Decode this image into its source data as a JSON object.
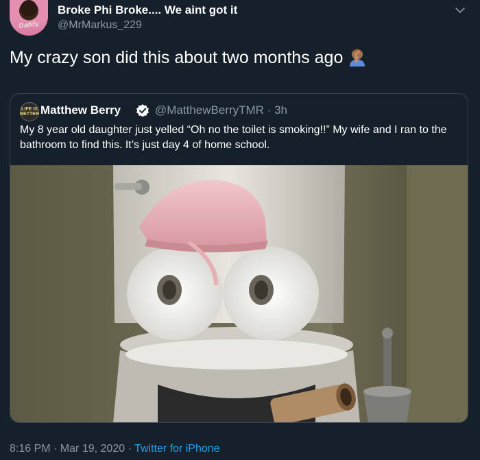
{
  "tweet": {
    "display_name": "Broke Phi Broke.... We aint got it",
    "handle": "@MrMarkus_229",
    "avatar_shirt_text": "Daddy",
    "text": "My crazy son did this about two months ago",
    "emoji": "facepalm-emoji",
    "more_icon": "chevron-down-icon"
  },
  "quoted": {
    "avatar_text": "LIFE IS BETTER",
    "name": "Matthew Berry",
    "verified_icon": "verified-badge-icon",
    "handle": "@MatthewBerryTMR",
    "separator": "·",
    "time": "3h",
    "text": "My 8 year old daughter just yelled “Oh no the toilet is smoking!!” My wife and I ran to the bathroom to find this. It’s just day 4 of home school.",
    "photo": "toilet-with-toilet-paper-face-photo"
  },
  "footer": {
    "time": "8:16 PM",
    "sep1": "·",
    "date": "Mar 19, 2020",
    "sep2": "·",
    "source": "Twitter for iPhone"
  },
  "colors": {
    "background": "#15202b",
    "secondary_text": "#8899a6",
    "link": "#1da1f2",
    "border": "#38444d"
  }
}
